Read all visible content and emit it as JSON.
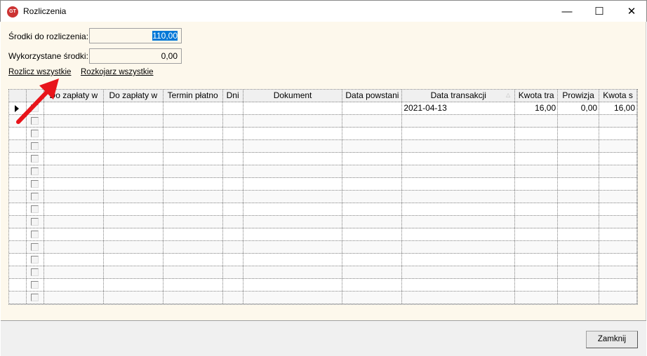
{
  "window": {
    "title": "Rozliczenia",
    "icon": "GT"
  },
  "form": {
    "funds_label": "Środki do rozliczenia:",
    "funds_value": "110,00",
    "used_label": "Wykorzystane środki:",
    "used_value": "0,00"
  },
  "links": {
    "settle_all": "Rozlicz wszystkie",
    "unmatch_all": "Rozkojarz wszystkie"
  },
  "grid": {
    "columns": [
      "",
      "",
      "Do zapłaty w",
      "Do zapłaty w",
      "Termin płatno",
      "Dni",
      "Dokument",
      "Data powstani",
      "Data transakcji",
      "Kwota tra",
      "Prowizja",
      "Kwota s"
    ],
    "rows": [
      [
        "",
        "",
        "",
        "",
        "",
        "",
        "2021-04-13",
        "16,00",
        "0,00",
        "16,00"
      ]
    ],
    "empty_rows": 15
  },
  "footer": {
    "close_label": "Zamknij"
  }
}
